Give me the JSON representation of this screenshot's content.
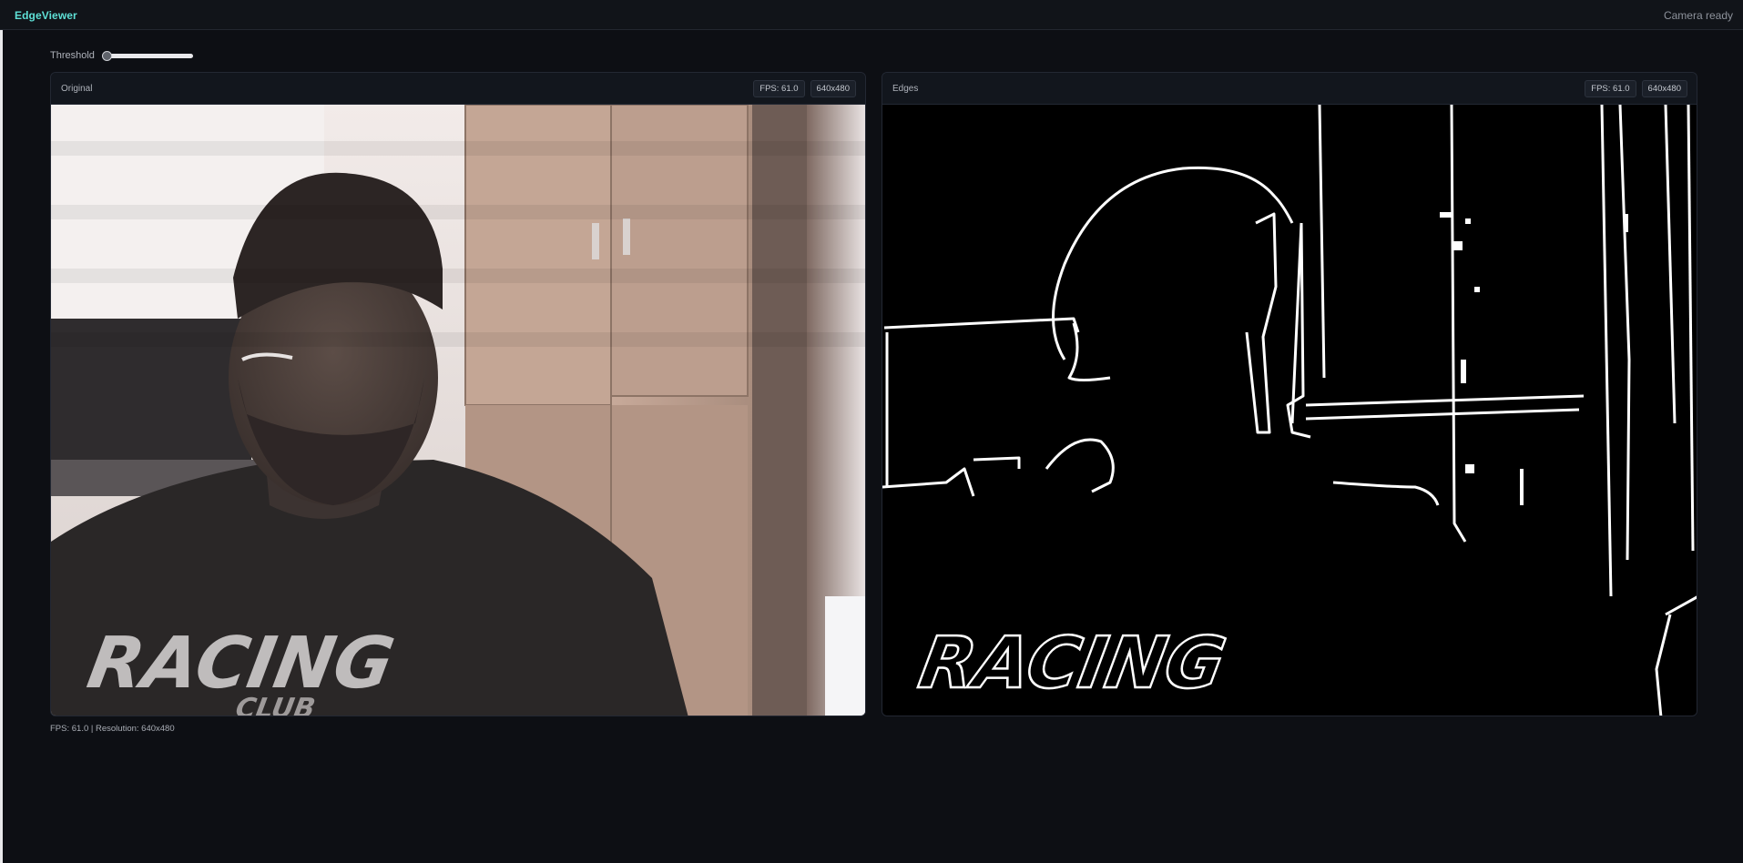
{
  "app": {
    "title": "EdgeViewer",
    "status": "Camera ready"
  },
  "controls": {
    "threshold_label": "Threshold",
    "threshold_value": 0.0
  },
  "panels": {
    "original": {
      "title": "Original",
      "fps_badge": "FPS: 61.0",
      "resolution_badge": "640x480"
    },
    "edges": {
      "title": "Edges",
      "fps_badge": "FPS: 61.0",
      "resolution_badge": "640x480"
    }
  },
  "footer": {
    "stats": "FPS: 61.0 | Resolution: 640x480"
  },
  "frames": {
    "shirt_print": "RACING",
    "shirt_print_sub": "CLUB"
  },
  "colors": {
    "accent": "#5ee0d6",
    "background": "#0d0f14",
    "panel": "#141820"
  }
}
